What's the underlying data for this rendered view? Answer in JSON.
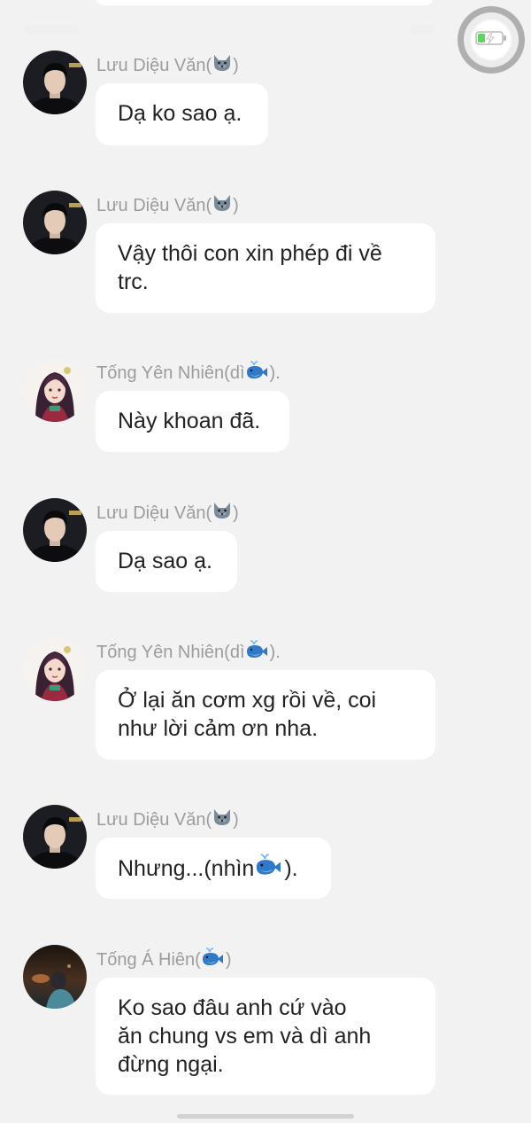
{
  "chat": {
    "messages": [
      {
        "sender": "Lưu Diệu Văn(",
        "sender_emoji": "wolf-emoji",
        "sender_suffix": ")",
        "avatar": "male-avatar",
        "lines": [
          "Dạ ko sao ạ."
        ]
      },
      {
        "sender": "Lưu Diệu Văn(",
        "sender_emoji": "wolf-emoji",
        "sender_suffix": ")",
        "avatar": "male-avatar",
        "lines": [
          "Vậy thôi con xin phép đi về",
          "trc."
        ]
      },
      {
        "sender": "Tống Yên Nhiên(dì ",
        "sender_emoji": "whale-emoji",
        "sender_suffix": ").",
        "avatar": "female-avatar",
        "lines": [
          "Này khoan đã."
        ]
      },
      {
        "sender": "Lưu Diệu Văn(",
        "sender_emoji": "wolf-emoji",
        "sender_suffix": ")",
        "avatar": "male-avatar",
        "lines": [
          "Dạ sao ạ."
        ]
      },
      {
        "sender": "Tống Yên Nhiên(dì ",
        "sender_emoji": "whale-emoji",
        "sender_suffix": ").",
        "avatar": "female-avatar",
        "lines": [
          "Ở lại ăn cơm xg rồi về, coi",
          "như lời cảm ơn nha."
        ]
      },
      {
        "sender": "Lưu Diệu Văn(",
        "sender_emoji": "wolf-emoji",
        "sender_suffix": ")",
        "avatar": "male-avatar",
        "text_before": "Nhưng...(nhìn ",
        "text_emoji": "whale-emoji",
        "text_after": ")."
      },
      {
        "sender": "Tống Á Hiên(",
        "sender_emoji": "whale-emoji",
        "sender_suffix": ")",
        "avatar": "night-avatar",
        "lines": [
          "Ko sao đâu anh cứ vào",
          "ăn chung vs em và dì anh",
          "đừng ngại."
        ]
      }
    ]
  },
  "overlay": {
    "floating_ball_icon": "battery-icon",
    "accent_green": "#5cd65c"
  },
  "colors": {
    "background": "#f2f2f2",
    "bubble": "#ffffff",
    "sender_name": "#9c9c9c",
    "message_text": "#222222"
  }
}
